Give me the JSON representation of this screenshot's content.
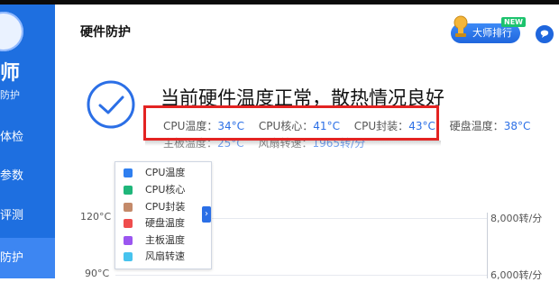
{
  "app": {
    "brand_big": "师",
    "brand_sub": "防护",
    "nav": [
      {
        "label": "体检",
        "active": false
      },
      {
        "label": "参数",
        "active": false
      },
      {
        "label": "评测",
        "active": false
      },
      {
        "label": "防护",
        "active": true
      }
    ]
  },
  "header": {
    "title": "硬件防护",
    "rank_label": "大师排行",
    "new_tag": "NEW"
  },
  "status": {
    "title": "当前硬件温度正常，散热情况良好",
    "temps": [
      {
        "label": "CPU温度：",
        "value": "34°C"
      },
      {
        "label": "CPU核心：",
        "value": "41°C"
      },
      {
        "label": "CPU封装：",
        "value": "43°C"
      },
      {
        "label": "硬盘温度：",
        "value": "38°C"
      }
    ],
    "temps_row2": [
      {
        "label": "主板温度：",
        "value": "25°C"
      },
      {
        "label": "风扇转速：",
        "value": "1965转/分"
      }
    ]
  },
  "legend": {
    "toggle": "›",
    "items": [
      {
        "label": "CPU温度",
        "color": "#2f7ff0"
      },
      {
        "label": "CPU核心",
        "color": "#1fb67a"
      },
      {
        "label": "CPU封装",
        "color": "#c48a6a"
      },
      {
        "label": "硬盘温度",
        "color": "#ef4d4d"
      },
      {
        "label": "主板温度",
        "color": "#9b56f0"
      },
      {
        "label": "风扇转速",
        "color": "#47c3ee"
      }
    ]
  },
  "chart": {
    "left_ticks": [
      "120°C",
      "90°C"
    ],
    "right_ticks": [
      "8,000转/分",
      "6,000转/分"
    ]
  }
}
